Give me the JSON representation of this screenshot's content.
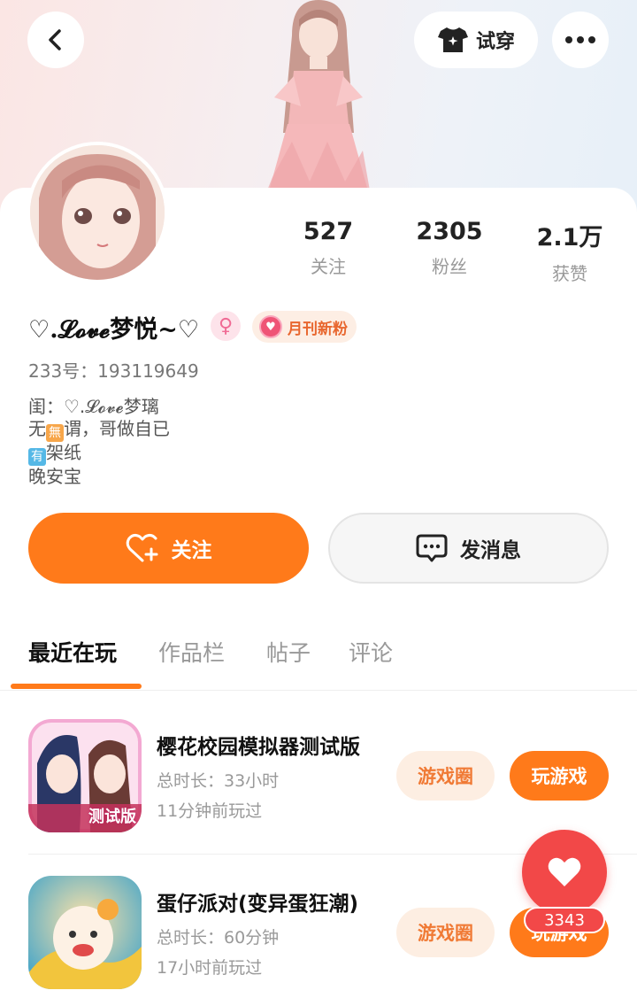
{
  "header": {
    "try_on_label": "试穿",
    "back_icon": "chevron-left-icon",
    "more_icon": "more-dots-icon"
  },
  "stats": [
    {
      "value": "527",
      "label": "关注"
    },
    {
      "value": "2305",
      "label": "粉丝"
    },
    {
      "value": "2.1万",
      "label": "获赞"
    }
  ],
  "profile": {
    "nickname": "♡.𝓛𝓸𝓿𝓮梦悦~♡",
    "gender_symbol": "♀",
    "fan_badge": "月刊新粉",
    "uid": "233号：193119649",
    "bio": {
      "line1": "闺：♡.𝓛𝓸𝓿𝓮梦璃",
      "line2_prefix": "无",
      "line2_box": "無",
      "line2_suffix": "谓，哥做自已",
      "line3_box": "有",
      "line3_suffix": "架纸",
      "line4": "晚安宝"
    }
  },
  "actions": {
    "follow_label": "关注",
    "message_label": "发消息"
  },
  "tabs": [
    {
      "label": "最近在玩",
      "active": true
    },
    {
      "label": "作品栏",
      "active": false
    },
    {
      "label": "帖子",
      "active": false
    },
    {
      "label": "评论",
      "active": false
    }
  ],
  "games": [
    {
      "title": "樱花校园模拟器测试版",
      "duration": "总时长：33小时",
      "last_played": "11分钟前玩过",
      "icon_caption": "测试版",
      "circle_label": "游戏圈",
      "play_label": "玩游戏"
    },
    {
      "title": "蛋仔派对(变异蛋狂潮)",
      "duration": "总时长：60分钟",
      "last_played": "17小时前玩过",
      "circle_label": "游戏圈",
      "play_label": "玩游戏"
    }
  ],
  "like": {
    "count": "3343"
  },
  "colors": {
    "accent": "#ff7a1a",
    "like_red": "#f24848",
    "secondary_text": "#999999"
  }
}
